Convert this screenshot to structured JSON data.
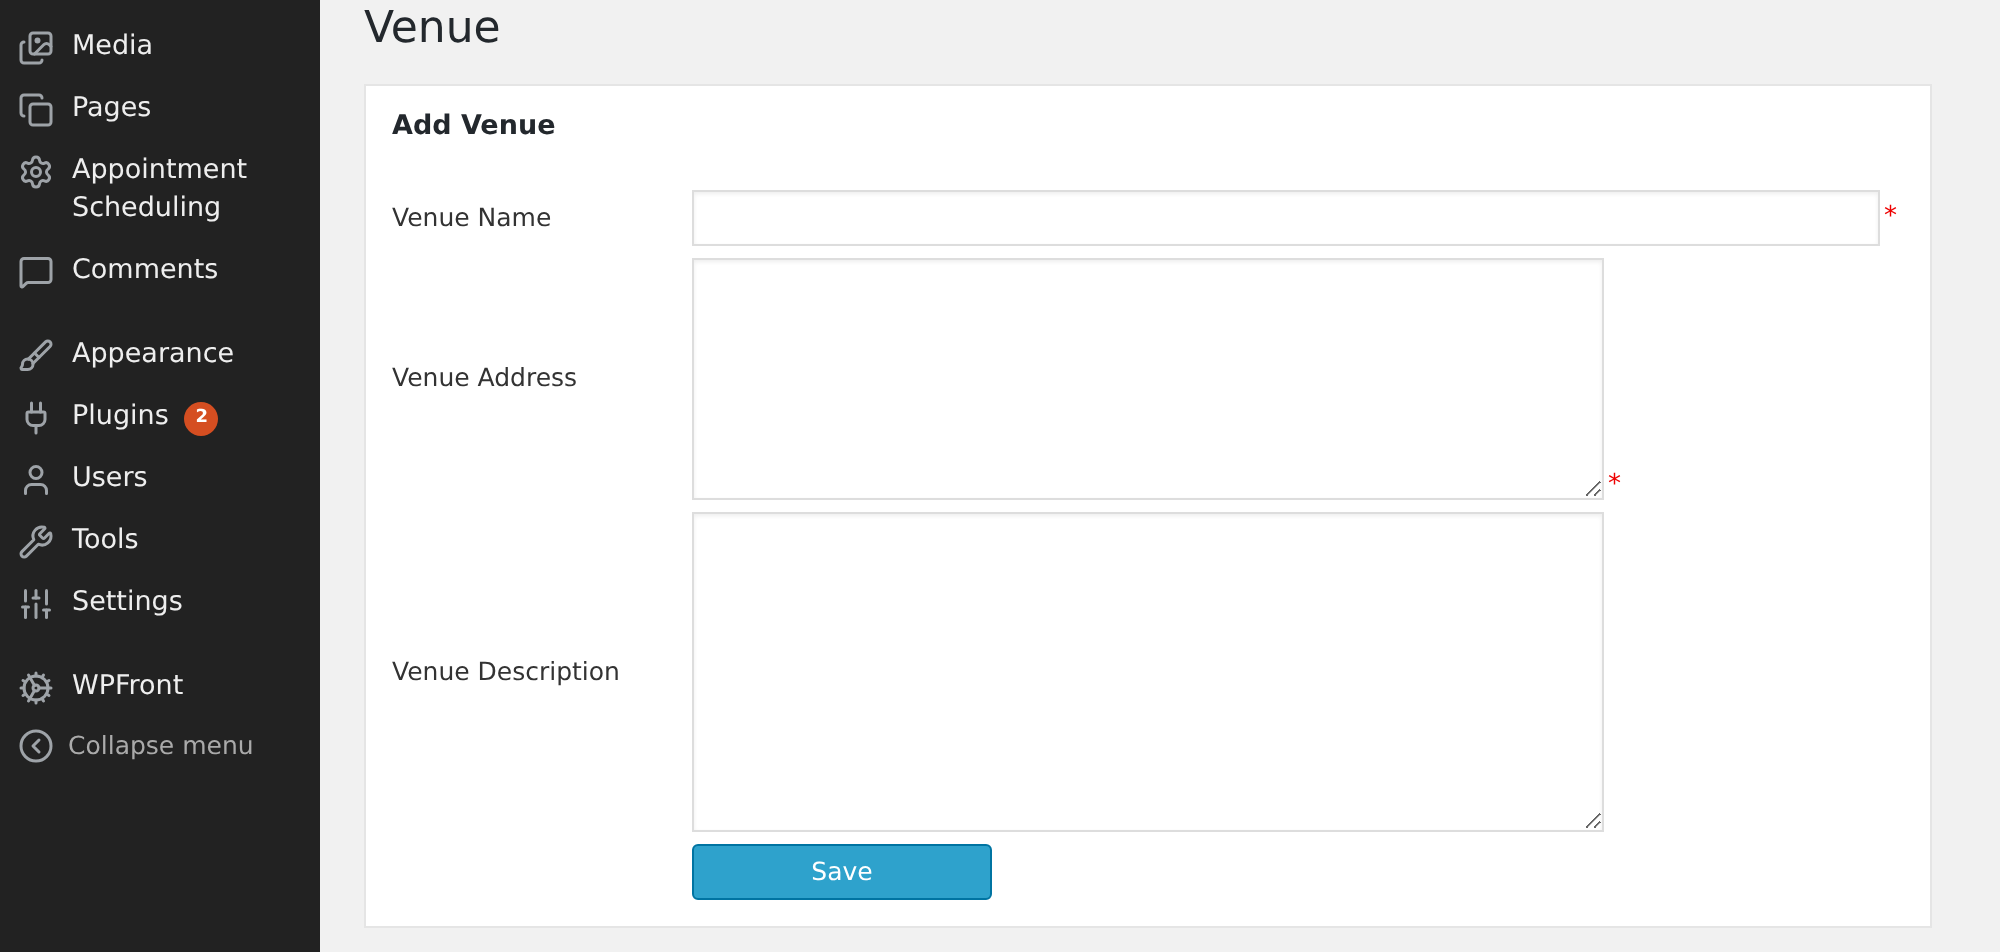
{
  "sidebar": {
    "groups": [
      {
        "items": [
          {
            "label": "Media"
          },
          {
            "label": "Pages"
          },
          {
            "label": "Appointment Scheduling"
          },
          {
            "label": "Comments"
          }
        ]
      },
      {
        "items": [
          {
            "label": "Appearance"
          },
          {
            "label": "Plugins",
            "badge": "2"
          },
          {
            "label": "Users"
          },
          {
            "label": "Tools"
          },
          {
            "label": "Settings"
          }
        ]
      },
      {
        "items": [
          {
            "label": "WPFront"
          }
        ]
      }
    ],
    "collapse": "Collapse menu"
  },
  "page_title": "Venue",
  "form": {
    "title": "Add Venue",
    "fields": [
      {
        "label": "Venue Name",
        "kind": "text",
        "required": true,
        "required_mark": "*"
      },
      {
        "label": "Venue Address",
        "kind": "textarea",
        "required": true,
        "required_mark": "*"
      },
      {
        "label": "Venue Description",
        "kind": "textarea",
        "required": false
      }
    ],
    "submit": "Save"
  }
}
